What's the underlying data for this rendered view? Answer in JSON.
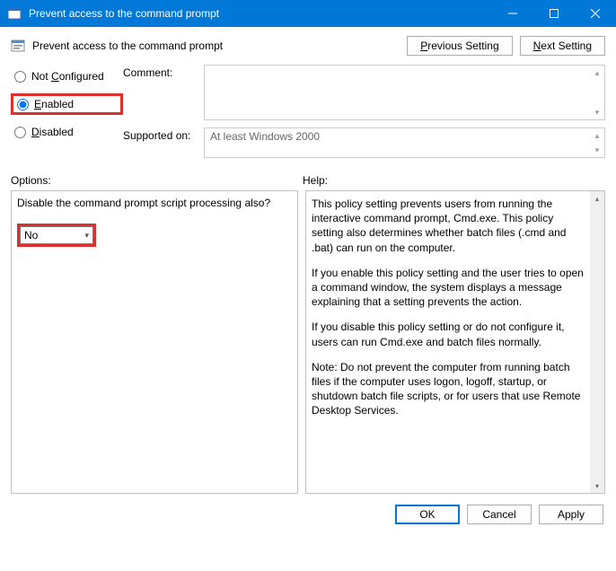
{
  "window": {
    "title": "Prevent access to the command prompt"
  },
  "header": {
    "title": "Prevent access to the command prompt",
    "prev": "Previous Setting",
    "next": "Next Setting"
  },
  "radios": {
    "not_configured_prefix": "Not ",
    "not_configured_key": "C",
    "not_configured_suffix": "onfigured",
    "enabled_key": "E",
    "enabled_suffix": "nabled",
    "disabled_key": "D",
    "disabled_suffix": "isabled"
  },
  "fields": {
    "comment_label": "Comment:",
    "supported_label": "Supported on:",
    "supported_value": "At least Windows 2000"
  },
  "lower": {
    "options_label": "Options:",
    "help_label": "Help:"
  },
  "options": {
    "question": "Disable the command prompt script processing also?",
    "select_value": "No"
  },
  "help": {
    "p1": "This policy setting prevents users from running the interactive command prompt, Cmd.exe.  This policy setting also determines whether batch files (.cmd and .bat) can run on the computer.",
    "p2": "If you enable this policy setting and the user tries to open a command window, the system displays a message explaining that a setting prevents the action.",
    "p3": "If you disable this policy setting or do not configure it, users can run Cmd.exe and batch files normally.",
    "p4": "Note: Do not prevent the computer from running batch files if the computer uses logon, logoff, startup, or shutdown batch file scripts, or for users that use Remote Desktop Services."
  },
  "footer": {
    "ok": "OK",
    "cancel": "Cancel",
    "apply": "Apply"
  }
}
